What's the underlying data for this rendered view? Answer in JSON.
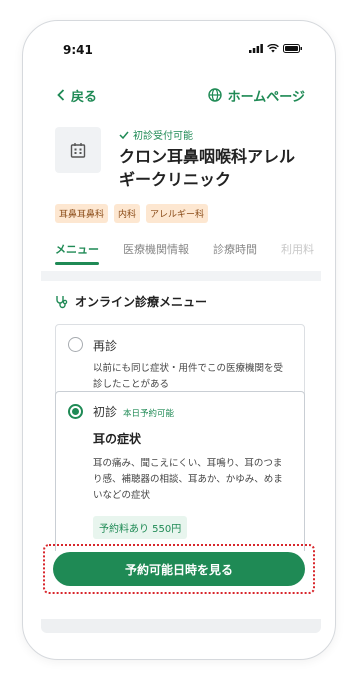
{
  "status_bar": {
    "time": "9:41"
  },
  "nav": {
    "back_label": "戻る",
    "home_label": "ホームページ"
  },
  "clinic": {
    "verified_label": "初診受付可能",
    "name": "クロン耳鼻咽喉科アレルギークリニック",
    "tags": [
      "耳鼻耳鼻科",
      "内科",
      "アレルギー科"
    ]
  },
  "tabs": [
    "メニュー",
    "医療機関情報",
    "診療時間",
    "利用料"
  ],
  "section": {
    "title": "オンライン診療メニュー"
  },
  "menu": {
    "revisit": {
      "title": "再診",
      "description": "以前にも同じ症状・用件でこの医療機関を受診したことがある"
    },
    "first_visit": {
      "title": "初診",
      "badge": "本日予約可能",
      "symptom_title": "耳の症状",
      "description": "耳の痛み、聞こえにくい、耳鳴り、耳のつまり感、補聴器の相談、耳あか、かゆみ、めまいなどの症状",
      "fee": "予約料あり 550円"
    }
  },
  "cta": {
    "label": "予約可能日時を見る"
  },
  "colors": {
    "accent": "#1f8a55",
    "highlight": "#d8262c",
    "tag_bg": "#fde7d1"
  }
}
